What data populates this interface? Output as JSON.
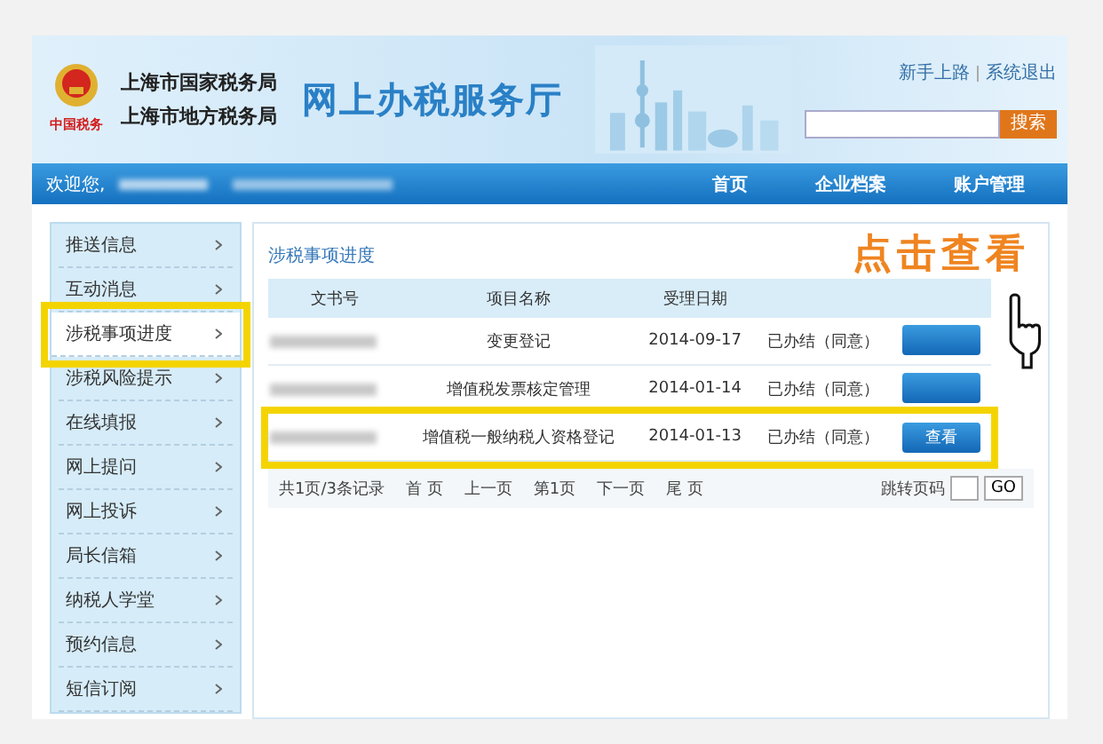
{
  "header": {
    "logo_text": "中国税务",
    "bureaus": [
      "上海市国家税务局",
      "上海市地方税务局"
    ],
    "site_title": "网上办税服务厅",
    "top_links": [
      "新手上路",
      "系统退出"
    ],
    "search": {
      "button": "搜索"
    }
  },
  "nav": {
    "welcome": "欢迎您,",
    "items": [
      "首页",
      "企业档案",
      "账户管理"
    ]
  },
  "sidebar": {
    "items": [
      {
        "label": "推送信息",
        "selected": false,
        "highlighted": false
      },
      {
        "label": "互动消息",
        "selected": false,
        "highlighted": false
      },
      {
        "label": "涉税事项进度",
        "selected": true,
        "highlighted": true
      },
      {
        "label": "涉税风险提示",
        "selected": false,
        "highlighted": false
      },
      {
        "label": "在线填报",
        "selected": false,
        "highlighted": false
      },
      {
        "label": "网上提问",
        "selected": false,
        "highlighted": false
      },
      {
        "label": "网上投诉",
        "selected": false,
        "highlighted": false
      },
      {
        "label": "局长信箱",
        "selected": false,
        "highlighted": false
      },
      {
        "label": "纳税人学堂",
        "selected": false,
        "highlighted": false
      },
      {
        "label": "预约信息",
        "selected": false,
        "highlighted": false
      },
      {
        "label": "短信订阅",
        "selected": false,
        "highlighted": false
      }
    ]
  },
  "panel": {
    "title": "涉税事项进度",
    "columns": [
      "文书号",
      "项目名称",
      "受理日期"
    ],
    "rows": [
      {
        "item": "变更登记",
        "date": "2014-09-17",
        "status": "已办结（同意）",
        "highlighted": false
      },
      {
        "item": "增值税发票核定管理",
        "date": "2014-01-14",
        "status": "已办结（同意）",
        "highlighted": false
      },
      {
        "item": "增值税一般纳税人资格登记",
        "date": "2014-01-13",
        "status": "已办结（同意）",
        "action": "查看",
        "highlighted": true
      }
    ],
    "pager": {
      "summary": "共1页/3条记录",
      "links": [
        "首 页",
        "上一页",
        "第1页",
        "下一页",
        "尾 页"
      ],
      "jump_label": "跳转页码",
      "go": "GO"
    }
  },
  "callout": {
    "text": "点击查看"
  }
}
